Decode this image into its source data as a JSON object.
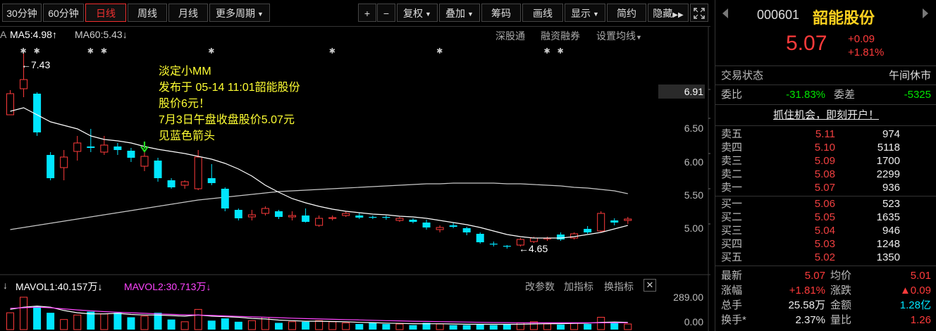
{
  "toolbar": {
    "periods": [
      {
        "label": "30分钟",
        "active": false
      },
      {
        "label": "60分钟",
        "active": false
      },
      {
        "label": "日线",
        "active": true
      },
      {
        "label": "周线",
        "active": false
      },
      {
        "label": "月线",
        "active": false
      },
      {
        "label": "更多周期",
        "active": false,
        "dropdown": true
      }
    ],
    "tools": [
      {
        "label": "+",
        "name": "zoom-in-button"
      },
      {
        "label": "−",
        "name": "zoom-out-button"
      },
      {
        "label": "复权",
        "name": "adjust-button",
        "dropdown": true
      },
      {
        "label": "叠加",
        "name": "overlay-button",
        "dropdown": true
      },
      {
        "label": "筹码",
        "name": "chips-button"
      },
      {
        "label": "画线",
        "name": "draw-line-button"
      },
      {
        "label": "显示",
        "name": "display-button",
        "dropdown": true
      },
      {
        "label": "简约",
        "name": "simple-button"
      },
      {
        "label": "隐藏",
        "name": "hide-button",
        "suffix": "▶▶"
      }
    ]
  },
  "ma_legend": {
    "prefix": "A",
    "ma5": "MA5:4.98",
    "ma5_arrow": "↑",
    "ma60": "MA60:5.43",
    "ma60_arrow": "↓",
    "links": [
      "深股通",
      "融资融券",
      "设置均线"
    ]
  },
  "annotation": {
    "lines": [
      "淡定小MM",
      "发布于 05-14 11:01韶能股份",
      "股价6元！",
      "7月3日午盘收盘股价5.07元",
      "见蓝色箭头"
    ]
  },
  "price_axis": {
    "labels": [
      {
        "value": "6.91",
        "highlight": true
      },
      {
        "value": "6.50",
        "highlight": false
      },
      {
        "value": "6.00",
        "highlight": false
      },
      {
        "value": "5.50",
        "highlight": false
      },
      {
        "value": "5.00",
        "highlight": false
      }
    ]
  },
  "markers": {
    "high": "←7.43",
    "low": "←4.65"
  },
  "volume": {
    "prefix_arrow": "↓",
    "mavol1": "MAVOL1:40.157万",
    "mavol1_arrow": "↓",
    "mavol2": "MAVOL2:30.713万",
    "mavol2_arrow": "↓",
    "links": [
      "改参数",
      "加指标",
      "换指标"
    ],
    "axis": [
      "289.00",
      "0.00"
    ]
  },
  "chart_data": {
    "type": "candlestick",
    "ylim": [
      4.4,
      7.5
    ],
    "candles": [
      {
        "o": 6.55,
        "h": 6.9,
        "l": 6.55,
        "c": 6.85,
        "up": true
      },
      {
        "o": 6.92,
        "h": 7.43,
        "l": 6.8,
        "c": 7.05,
        "up": true
      },
      {
        "o": 6.85,
        "h": 6.87,
        "l": 6.25,
        "c": 6.3,
        "up": false
      },
      {
        "o": 5.98,
        "h": 6.02,
        "l": 5.62,
        "c": 5.65,
        "up": false
      },
      {
        "o": 5.8,
        "h": 6.05,
        "l": 5.62,
        "c": 5.95,
        "up": true
      },
      {
        "o": 6.03,
        "h": 6.25,
        "l": 5.9,
        "c": 6.15,
        "up": true
      },
      {
        "o": 6.1,
        "h": 6.35,
        "l": 6.02,
        "c": 6.08,
        "up": false
      },
      {
        "o": 6.02,
        "h": 6.25,
        "l": 5.98,
        "c": 6.12,
        "up": true
      },
      {
        "o": 6.1,
        "h": 6.15,
        "l": 5.98,
        "c": 6.05,
        "up": false
      },
      {
        "o": 6.04,
        "h": 6.08,
        "l": 5.88,
        "c": 5.94,
        "up": false
      },
      {
        "o": 5.82,
        "h": 6.02,
        "l": 5.75,
        "c": 5.96,
        "up": true
      },
      {
        "o": 5.9,
        "h": 5.94,
        "l": 5.6,
        "c": 5.65,
        "up": false
      },
      {
        "o": 5.62,
        "h": 5.65,
        "l": 5.5,
        "c": 5.52,
        "up": false
      },
      {
        "o": 5.55,
        "h": 5.62,
        "l": 5.5,
        "c": 5.6,
        "up": true
      },
      {
        "o": 5.5,
        "h": 6.05,
        "l": 5.48,
        "c": 5.95,
        "up": true
      },
      {
        "o": 5.65,
        "h": 5.85,
        "l": 5.55,
        "c": 5.58,
        "up": false
      },
      {
        "o": 5.5,
        "h": 5.52,
        "l": 5.18,
        "c": 5.22,
        "up": false
      },
      {
        "o": 5.2,
        "h": 5.22,
        "l": 5.05,
        "c": 5.08,
        "up": false
      },
      {
        "o": 5.1,
        "h": 5.2,
        "l": 5.05,
        "c": 5.13,
        "up": true
      },
      {
        "o": 5.15,
        "h": 5.25,
        "l": 5.12,
        "c": 5.22,
        "up": true
      },
      {
        "o": 5.18,
        "h": 5.2,
        "l": 5.07,
        "c": 5.1,
        "up": false
      },
      {
        "o": 5.12,
        "h": 5.18,
        "l": 5.05,
        "c": 5.1,
        "up": true
      },
      {
        "o": 5.12,
        "h": 5.22,
        "l": 5.02,
        "c": 5.03,
        "up": false
      },
      {
        "o": 4.98,
        "h": 5.12,
        "l": 4.96,
        "c": 5.08,
        "up": true
      },
      {
        "o": 5.08,
        "h": 5.12,
        "l": 5.05,
        "c": 5.09,
        "up": true
      },
      {
        "o": 5.12,
        "h": 5.18,
        "l": 5.1,
        "c": 5.15,
        "up": true
      },
      {
        "o": 5.12,
        "h": 5.16,
        "l": 5.07,
        "c": 5.09,
        "up": false
      },
      {
        "o": 5.1,
        "h": 5.12,
        "l": 5.07,
        "c": 5.09,
        "up": false
      },
      {
        "o": 5.1,
        "h": 5.12,
        "l": 5.06,
        "c": 5.09,
        "up": false
      },
      {
        "o": 5.08,
        "h": 5.1,
        "l": 5.03,
        "c": 5.05,
        "up": true
      },
      {
        "o": 5.06,
        "h": 5.08,
        "l": 5.01,
        "c": 5.03,
        "up": false
      },
      {
        "o": 5.02,
        "h": 5.06,
        "l": 4.92,
        "c": 4.95,
        "up": false
      },
      {
        "o": 4.92,
        "h": 4.98,
        "l": 4.88,
        "c": 4.95,
        "up": true
      },
      {
        "o": 4.98,
        "h": 5.02,
        "l": 4.94,
        "c": 4.96,
        "up": false
      },
      {
        "o": 4.94,
        "h": 4.96,
        "l": 4.84,
        "c": 4.88,
        "up": false
      },
      {
        "o": 4.86,
        "h": 4.88,
        "l": 4.72,
        "c": 4.74,
        "up": false
      },
      {
        "o": 4.72,
        "h": 4.75,
        "l": 4.68,
        "c": 4.72,
        "up": false
      },
      {
        "o": 4.68,
        "h": 4.7,
        "l": 4.65,
        "c": 4.69,
        "up": false
      },
      {
        "o": 4.7,
        "h": 4.8,
        "l": 4.68,
        "c": 4.78,
        "up": true
      },
      {
        "o": 4.75,
        "h": 4.82,
        "l": 4.73,
        "c": 4.8,
        "up": true
      },
      {
        "o": 4.8,
        "h": 4.82,
        "l": 4.76,
        "c": 4.8,
        "up": true
      },
      {
        "o": 4.78,
        "h": 4.88,
        "l": 4.76,
        "c": 4.85,
        "up": false
      },
      {
        "o": 4.8,
        "h": 4.88,
        "l": 4.78,
        "c": 4.86,
        "up": true
      },
      {
        "o": 4.88,
        "h": 4.97,
        "l": 4.86,
        "c": 4.93,
        "up": false
      },
      {
        "o": 4.9,
        "h": 5.18,
        "l": 4.88,
        "c": 5.15,
        "up": true
      },
      {
        "o": 5.02,
        "h": 5.08,
        "l": 4.98,
        "c": 5.05,
        "up": false
      },
      {
        "o": 5.05,
        "h": 5.1,
        "l": 5.0,
        "c": 5.07,
        "up": true
      }
    ],
    "ma5": [
      6.6,
      6.65,
      6.55,
      6.45,
      6.4,
      6.35,
      6.25,
      6.2,
      6.18,
      6.15,
      6.1,
      6.06,
      6.03,
      6.0,
      5.96,
      5.92,
      5.86,
      5.78,
      5.68,
      5.55,
      5.45,
      5.36,
      5.3,
      5.25,
      5.21,
      5.18,
      5.16,
      5.14,
      5.13,
      5.11,
      5.1,
      5.08,
      5.05,
      5.02,
      4.99,
      4.95,
      4.9,
      4.85,
      4.82,
      4.8,
      4.8,
      4.8,
      4.82,
      4.85,
      4.88,
      4.93,
      4.98
    ],
    "ma60": [
      4.92,
      4.95,
      4.98,
      5.01,
      5.04,
      5.07,
      5.1,
      5.13,
      5.16,
      5.19,
      5.22,
      5.25,
      5.28,
      5.31,
      5.34,
      5.36,
      5.38,
      5.4,
      5.42,
      5.44,
      5.46,
      5.47,
      5.48,
      5.49,
      5.5,
      5.51,
      5.52,
      5.53,
      5.54,
      5.55,
      5.56,
      5.57,
      5.57,
      5.58,
      5.58,
      5.58,
      5.58,
      5.57,
      5.57,
      5.56,
      5.55,
      5.54,
      5.52,
      5.51,
      5.49,
      5.47,
      5.43
    ],
    "volumes": [
      150,
      289,
      210,
      150,
      90,
      130,
      160,
      140,
      150,
      110,
      120,
      150,
      90,
      70,
      180,
      80,
      100,
      70,
      80,
      110,
      60,
      70,
      70,
      80,
      70,
      60,
      50,
      60,
      50,
      50,
      40,
      60,
      50,
      40,
      40,
      50,
      40,
      50,
      60,
      70,
      50,
      45,
      60,
      50,
      110,
      60,
      50
    ],
    "mavol1": [
      180,
      200,
      210,
      200,
      170,
      150,
      140,
      140,
      145,
      135,
      130,
      130,
      125,
      120,
      130,
      120,
      115,
      110,
      100,
      95,
      85,
      80,
      75,
      75,
      72,
      70,
      65,
      62,
      58,
      55,
      53,
      52,
      52,
      50,
      48,
      48,
      47,
      47,
      48,
      50,
      52,
      53,
      55,
      57,
      65,
      68,
      64
    ],
    "mavol2": [
      190,
      195,
      200,
      195,
      185,
      175,
      168,
      160,
      155,
      150,
      145,
      140,
      136,
      132,
      130,
      126,
      122,
      118,
      114,
      110,
      106,
      102,
      98,
      95,
      92,
      89,
      86,
      83,
      80,
      78,
      75,
      73,
      71,
      69,
      67,
      65,
      63,
      62,
      61,
      60,
      60,
      60,
      60,
      60,
      61,
      61,
      61
    ]
  },
  "panel": {
    "code": "000601",
    "name": "韶能股份",
    "price": "5.07",
    "change": "+0.09",
    "change_pct": "+1.81%",
    "status_label": "交易状态",
    "status_value": "午间休市",
    "weibi_label": "委比",
    "weibi_value": "-31.83%",
    "weicha_label": "委差",
    "weicha_value": "-5325",
    "promo": "抓住机会，即刻开户！",
    "asks": [
      {
        "label": "卖五",
        "price": "5.11",
        "volume": "974"
      },
      {
        "label": "卖四",
        "price": "5.10",
        "volume": "5118"
      },
      {
        "label": "卖三",
        "price": "5.09",
        "volume": "1700"
      },
      {
        "label": "卖二",
        "price": "5.08",
        "volume": "2299"
      },
      {
        "label": "卖一",
        "price": "5.07",
        "volume": "936"
      }
    ],
    "bids": [
      {
        "label": "买一",
        "price": "5.06",
        "volume": "523"
      },
      {
        "label": "买二",
        "price": "5.05",
        "volume": "1635"
      },
      {
        "label": "买三",
        "price": "5.04",
        "volume": "946"
      },
      {
        "label": "买四",
        "price": "5.03",
        "volume": "1248"
      },
      {
        "label": "买五",
        "price": "5.02",
        "volume": "1350"
      }
    ],
    "stats": [
      {
        "l1": "最新",
        "v1": "5.07",
        "c1": "red",
        "l2": "均价",
        "v2": "5.01",
        "c2": "red"
      },
      {
        "l1": "涨幅",
        "v1": "+1.81%",
        "c1": "red",
        "l2": "涨跌",
        "v2": "▲0.09",
        "c2": "red"
      },
      {
        "l1": "总手",
        "v1": "25.58万",
        "c1": "white",
        "l2": "金额",
        "v2": "1.28亿",
        "c2": "cyan"
      },
      {
        "l1": "换手*",
        "v1": "2.37%",
        "c1": "white",
        "l2": "量比",
        "v2": "1.26",
        "c2": "red"
      }
    ]
  },
  "colors": {
    "up": "#ff3b3b",
    "down": "#00e5ff",
    "ma5": "#ffffff",
    "ma60": "#c8c8c8",
    "mavol2": "#ff44ff",
    "annotation": "#ffff33",
    "arrow": "#22dd22"
  }
}
